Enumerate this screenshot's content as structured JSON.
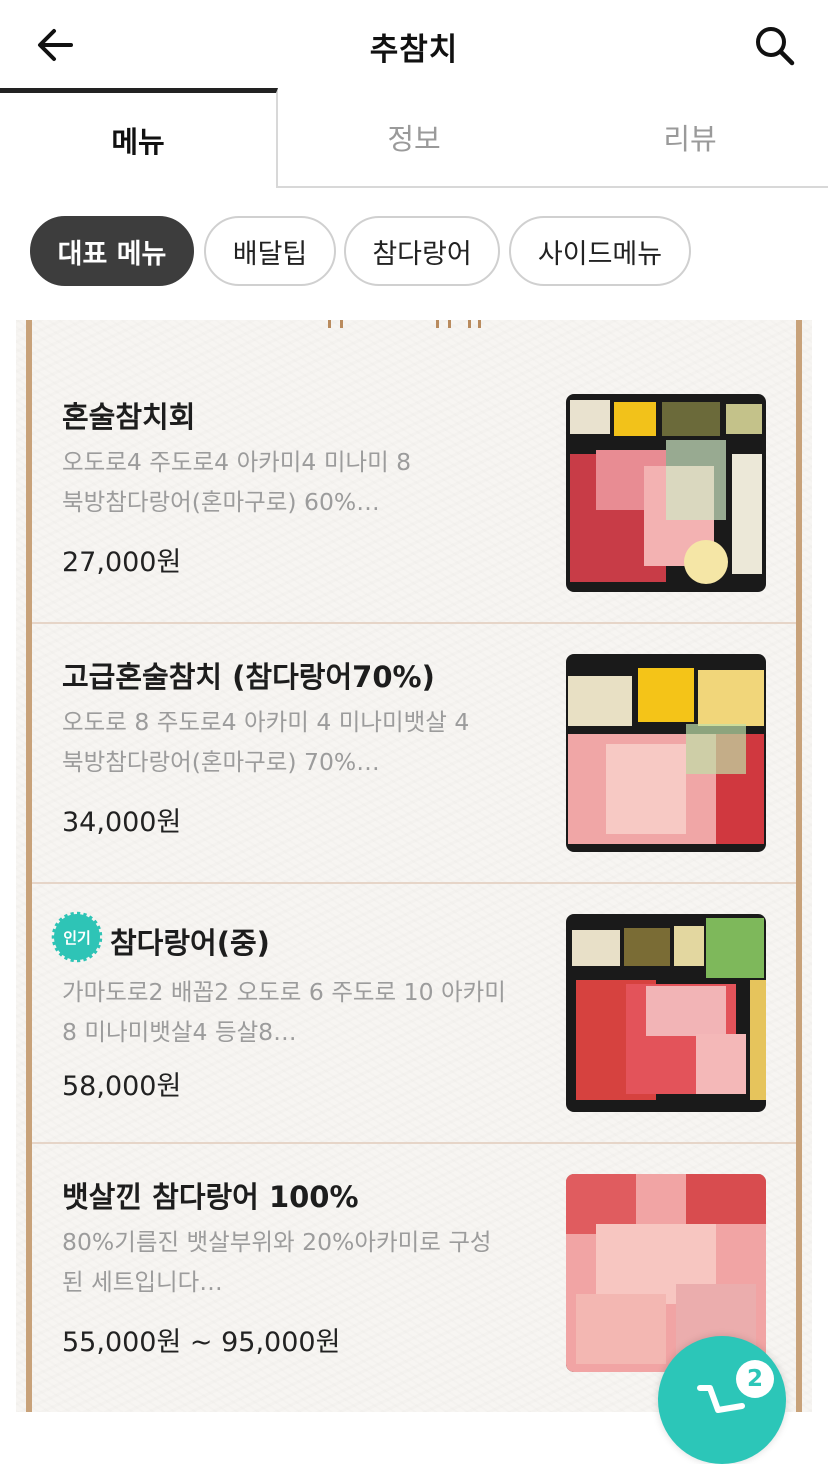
{
  "header": {
    "title": "추참치"
  },
  "tabs": [
    {
      "label": "메뉴"
    },
    {
      "label": "정보"
    },
    {
      "label": "리뷰"
    }
  ],
  "chips": [
    {
      "label": "대표 메뉴"
    },
    {
      "label": "배달팁"
    },
    {
      "label": "참다랑어"
    },
    {
      "label": "사이드메뉴"
    }
  ],
  "menu_items": [
    {
      "name": "혼술참치회",
      "desc_line1": "오도로4 주도로4 아카미4 미나미 8",
      "desc_line2": "북방참다랑어(혼마구로) 60%…",
      "price": "27,000원",
      "badge": ""
    },
    {
      "name": "고급혼술참치 (참다랑어70%)",
      "desc_line1": "오도로 8 주도로4 아카미 4 미나미뱃살 4",
      "desc_line2": "북방참다랑어(혼마구로) 70%…",
      "price": "34,000원",
      "badge": ""
    },
    {
      "name": "참다랑어(중)",
      "desc_line1": "가마도로2 배꼽2 오도로 6 주도로 10  아카미",
      "desc_line2": "8 미나미뱃살4 등살8…",
      "price": "58,000원",
      "badge": "인기"
    },
    {
      "name": "뱃살낀 참다랑어 100%",
      "desc_line1": "80%기름진 뱃살부위와 20%아카미로 구성",
      "desc_line2": "된 세트입니다…",
      "price": "55,000원 ~ 95,000원",
      "badge": ""
    }
  ],
  "cart": {
    "count": "2"
  },
  "colors": {
    "accent": "#2cc6b8",
    "rail": "#c8a27a",
    "chip_active": "#3d3d3d"
  }
}
